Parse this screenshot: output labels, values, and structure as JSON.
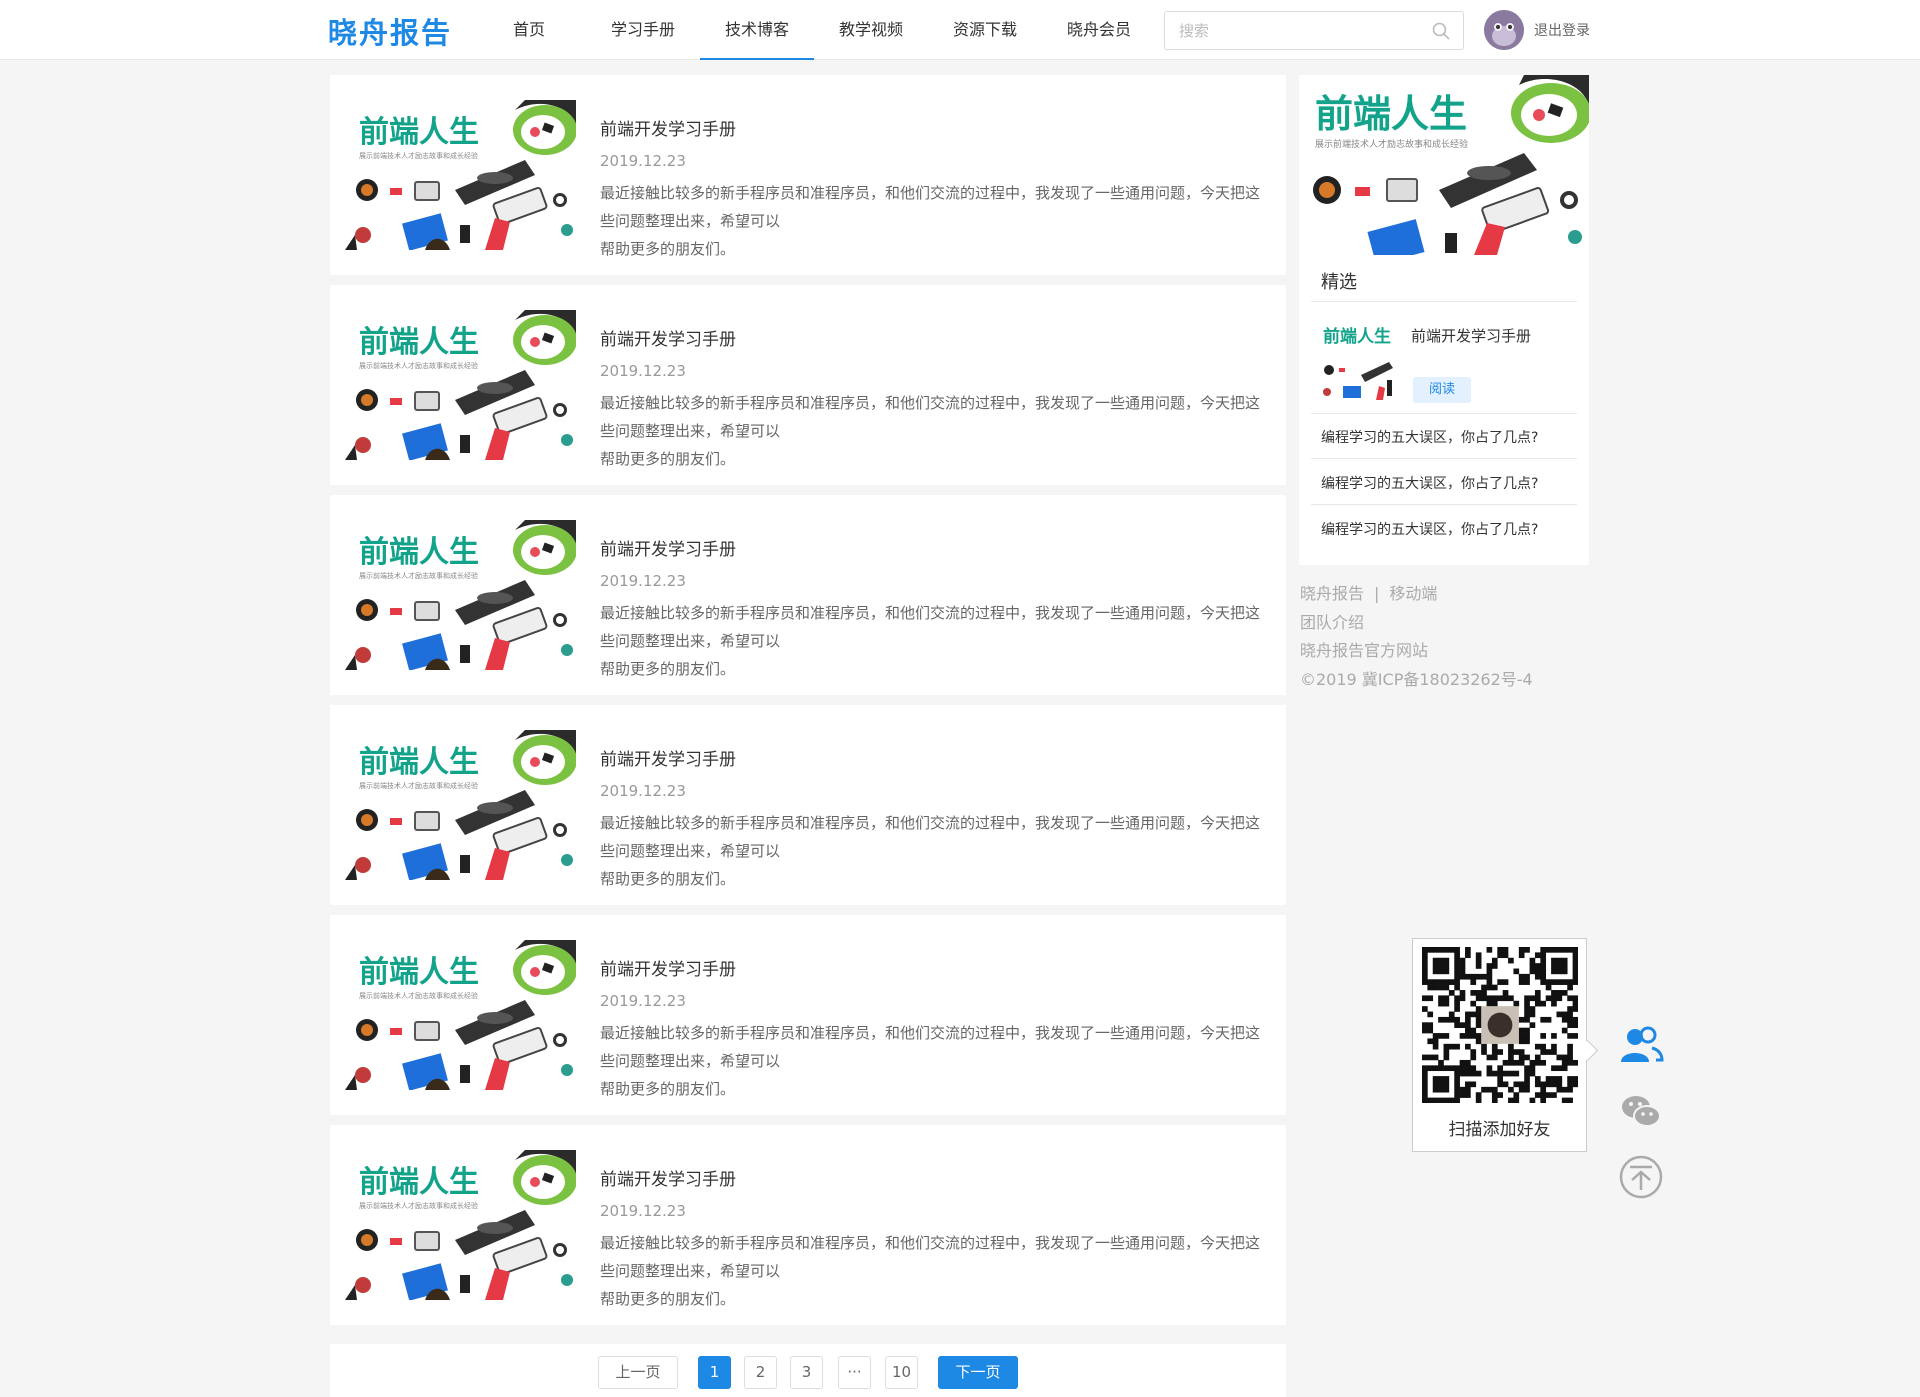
{
  "colors": {
    "accent": "#1e88e5",
    "text": "#333333",
    "muted": "#999999",
    "bg": "#f5f5f5"
  },
  "header": {
    "logo": "晓舟报告",
    "nav": [
      "首页",
      "学习手册",
      "技术博客",
      "教学视频",
      "资源下载",
      "晓舟会员"
    ],
    "active_nav": "技术博客",
    "search_placeholder": "搜索",
    "logout": "退出登录"
  },
  "thumb": {
    "brand": "前端人生",
    "tagline": "展示前端技术人才励志故事和成长经验"
  },
  "articles": [
    {
      "title": "前端开发学习手册",
      "date": "2019.12.23",
      "excerpt_1": "最近接触比较多的新手程序员和准程序员，和他们交流的过程中，我发现了一些通用问题，今天把这些问题整理出来，希望可以",
      "excerpt_2": "帮助更多的朋友们。"
    },
    {
      "title": "前端开发学习手册",
      "date": "2019.12.23",
      "excerpt_1": "最近接触比较多的新手程序员和准程序员，和他们交流的过程中，我发现了一些通用问题，今天把这些问题整理出来，希望可以",
      "excerpt_2": "帮助更多的朋友们。"
    },
    {
      "title": "前端开发学习手册",
      "date": "2019.12.23",
      "excerpt_1": "最近接触比较多的新手程序员和准程序员，和他们交流的过程中，我发现了一些通用问题，今天把这些问题整理出来，希望可以",
      "excerpt_2": "帮助更多的朋友们。"
    },
    {
      "title": "前端开发学习手册",
      "date": "2019.12.23",
      "excerpt_1": "最近接触比较多的新手程序员和准程序员，和他们交流的过程中，我发现了一些通用问题，今天把这些问题整理出来，希望可以",
      "excerpt_2": "帮助更多的朋友们。"
    },
    {
      "title": "前端开发学习手册",
      "date": "2019.12.23",
      "excerpt_1": "最近接触比较多的新手程序员和准程序员，和他们交流的过程中，我发现了一些通用问题，今天把这些问题整理出来，希望可以",
      "excerpt_2": "帮助更多的朋友们。"
    },
    {
      "title": "前端开发学习手册",
      "date": "2019.12.23",
      "excerpt_1": "最近接触比较多的新手程序员和准程序员，和他们交流的过程中，我发现了一些通用问题，今天把这些问题整理出来，希望可以",
      "excerpt_2": "帮助更多的朋友们。"
    }
  ],
  "pagination": {
    "prev": "上一页",
    "pages": [
      "1",
      "2",
      "3",
      "···",
      "10"
    ],
    "current": "1",
    "next": "下一页"
  },
  "sidebar": {
    "heading": "精选",
    "featured": {
      "title": "前端开发学习手册",
      "button": "阅读"
    },
    "links": [
      "编程学习的五大误区，你占了几点?",
      "编程学习的五大误区，你占了几点?",
      "编程学习的五大误区，你占了几点?"
    ]
  },
  "footer": {
    "line1_a": "晓舟报告",
    "line1_sep": "|",
    "line1_b": "移动端",
    "line2": "团队介绍",
    "line3": "晓舟报告官方网站",
    "line4": "©2019 冀ICP备18023262号-4"
  },
  "qr": {
    "caption": "扫描添加好友"
  },
  "float_buttons": [
    "contacts-icon",
    "wechat-icon",
    "back-to-top-icon"
  ]
}
